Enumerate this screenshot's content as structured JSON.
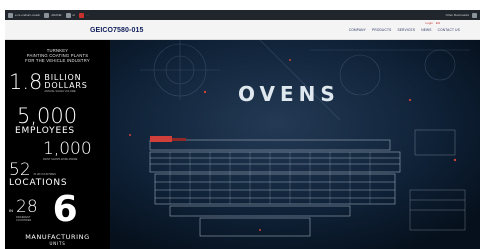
{
  "browser": {
    "bookmarks": [
      "e-rs-ondiurn-coatin",
      "ARANE",
      "ef",
      "..."
    ],
    "right_text": "Other Bookmarks"
  },
  "header": {
    "logo_text": "GEICO7580-015",
    "util_links": [
      "Login",
      "EN"
    ],
    "nav": [
      "COMPANY",
      "PRODUCTS",
      "SERVICES",
      "NEWS",
      "CONTACT US"
    ]
  },
  "sidebar": {
    "intro": "TURNKEY\nPAINTING COATING PLANTS\nFOR THE VEHICLE INDUSTRY",
    "stat1": {
      "value": "1.8",
      "line1": "BILLION",
      "line2": "DOLLARS",
      "note": "ANNUAL SALES VOLUME"
    },
    "stat2": {
      "value": "5,000",
      "word": "EMPLOYEES"
    },
    "stat3": {
      "value": "1,000",
      "note": "PAINT SHOPS WORLDWIDE"
    },
    "stat4": {
      "value": "52",
      "word": "LOCATIONS",
      "note": "IN 28 COUNTRIES"
    },
    "stat5": {
      "prefix": "IN",
      "value": "28",
      "note_a": "DIFFERENT",
      "note_b": "COUNTRIES",
      "value2": "6",
      "word": "MANUFACTURING",
      "word2": "UNITS"
    }
  },
  "hero": {
    "title": "OVENS"
  },
  "colors": {
    "sidebar_bg": "#000000",
    "hero_bg": "#0a1a2e",
    "brand_blue": "#0f1c5a",
    "brand_red": "#c8322e"
  }
}
